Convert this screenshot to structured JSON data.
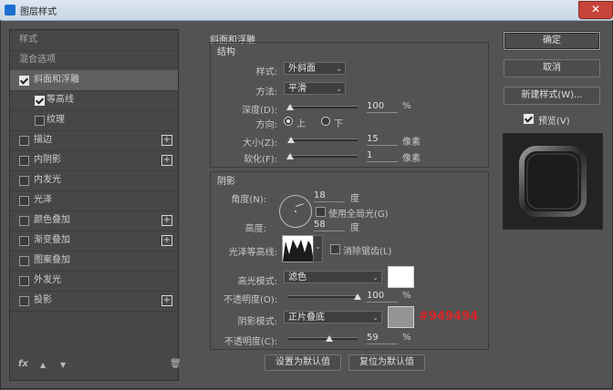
{
  "window": {
    "title": "图层样式"
  },
  "sidebar": {
    "items": [
      {
        "label": "样式",
        "kind": "head"
      },
      {
        "label": "混合选项",
        "kind": "head"
      },
      {
        "label": "斜面和浮雕",
        "checked": true,
        "selected": true
      },
      {
        "label": "等高线",
        "checked": true,
        "sub": true
      },
      {
        "label": "纹理",
        "checked": false,
        "sub": true
      },
      {
        "label": "描边",
        "checked": false,
        "plus": true
      },
      {
        "label": "内阴影",
        "checked": false,
        "plus": true
      },
      {
        "label": "内发光",
        "checked": false
      },
      {
        "label": "光泽",
        "checked": false
      },
      {
        "label": "颜色叠加",
        "checked": false,
        "plus": true
      },
      {
        "label": "渐变叠加",
        "checked": false,
        "plus": true
      },
      {
        "label": "图案叠加",
        "checked": false
      },
      {
        "label": "外发光",
        "checked": false
      },
      {
        "label": "投影",
        "checked": false,
        "plus": true
      }
    ],
    "footer": {
      "fx": "fx",
      "up": "▲",
      "down": "▼",
      "trash": "🗑"
    }
  },
  "bevel": {
    "group_title": "斜面和浮雕",
    "structure_title": "结构",
    "style_label": "样式:",
    "style_value": "外斜面",
    "technique_label": "方法:",
    "technique_value": "平滑",
    "depth_label": "深度(D):",
    "depth_value": "100",
    "depth_unit": "%",
    "direction_label": "方向:",
    "direction_up": "上",
    "direction_down": "下",
    "size_label": "大小(Z):",
    "size_value": "15",
    "size_unit": "像素",
    "soften_label": "软化(F):",
    "soften_value": "1",
    "soften_unit": "像素"
  },
  "shading": {
    "title": "阴影",
    "angle_label": "角度(N):",
    "angle_value": "18",
    "angle_unit": "度",
    "global_light_label": "使用全局光(G)",
    "altitude_label": "高度:",
    "altitude_value": "58",
    "altitude_unit": "度",
    "gloss_label": "光泽等高线:",
    "antialias_label": "消除锯齿(L)",
    "highlight_label": "高光模式:",
    "highlight_value": "滤色",
    "highlight_opacity_label": "不透明度(O):",
    "highlight_opacity_value": "100",
    "highlight_opacity_unit": "%",
    "shadow_label": "阴影模式:",
    "shadow_value": "正片叠底",
    "shadow_opacity_label": "不透明度(C):",
    "shadow_opacity_value": "59",
    "shadow_opacity_unit": "%",
    "highlight_color": "#ffffff",
    "shadow_color": "#949494",
    "shadow_hex_annotation": "#949494"
  },
  "buttons": {
    "set_default": "设置为默认值",
    "reset_default": "复位为默认值",
    "ok": "确定",
    "cancel": "取消",
    "new_style": "新建样式(W)...",
    "preview_label": "预览(V)"
  },
  "sliders": {
    "depth_fraction": 0.03,
    "size_fraction": 0.04,
    "soften_fraction": 0.02,
    "highlight_opacity_fraction": 1.0,
    "shadow_opacity_fraction": 0.59
  }
}
